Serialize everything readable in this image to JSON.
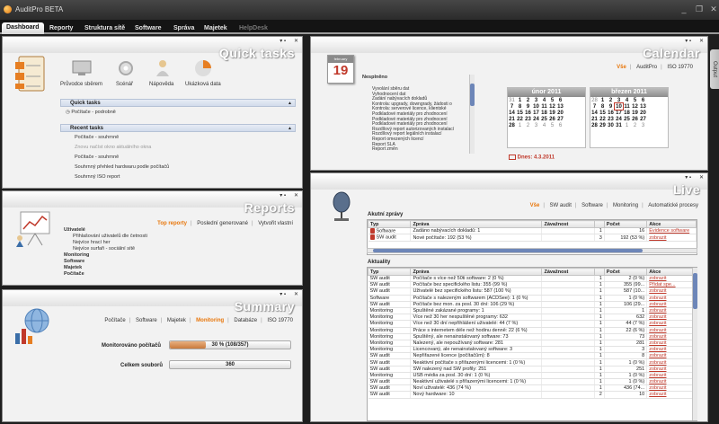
{
  "app": {
    "title": "AuditPro BETA"
  },
  "nav": {
    "tabs": [
      "Dashboard",
      "Reporty",
      "Struktura sítě",
      "Software",
      "Správa",
      "Majetek",
      "HelpDesk"
    ]
  },
  "side_tab": "Output",
  "quick_tasks": {
    "title": "Quick tasks",
    "icons": [
      "Průvodce sběrem",
      "Scénář",
      "Nápověda",
      "Ukázková data"
    ],
    "quick_header": "Quick tasks",
    "quick_items": [
      "Počítače - podrobně"
    ],
    "recent_header": "Recent tasks",
    "recent_items": [
      "Počítače - souhrnně",
      "Znovu načíst okno aktuálního okna",
      "Počítače - souhrnně",
      "Souhrnný přehled hardwaru podle počítačů",
      "Souhrnný ISO report"
    ]
  },
  "calendar": {
    "title": "Calendar",
    "tabs": [
      "Vše",
      "AuditPro",
      "ISO 19770"
    ],
    "icon_month": "february",
    "icon_day": "19",
    "list_header": "Nesplněno",
    "list": [
      "Vyvolání sběru dat",
      "Vyhodnocení dat",
      "Zadání nabývacích dokladů",
      "Kontrola: upgrady, downgrady, žádosti o",
      "Kontrola: serverové licence, klientské",
      "Podkladové materiály pro zhodnocení",
      "Podkladové materiály pro zhodnocení",
      "Podkladové materiály pro zhodnocení",
      "Rozdílový report autorizovaných instalací",
      "Rozdílový report legálních instalací",
      "Report omezených licencí",
      "Report SLA",
      "Report změn"
    ],
    "month1": {
      "name": "únor 2011",
      "rows": [
        [
          "31",
          "1",
          "2",
          "3",
          "4",
          "5",
          "6"
        ],
        [
          "7",
          "8",
          "9",
          "10",
          "11",
          "12",
          "13"
        ],
        [
          "14",
          "15",
          "16",
          "17",
          "18",
          "19",
          "20"
        ],
        [
          "21",
          "22",
          "23",
          "24",
          "25",
          "26",
          "27"
        ],
        [
          "28",
          "1",
          "2",
          "3",
          "4",
          "5",
          "6"
        ]
      ]
    },
    "month2": {
      "name": "březen 2011",
      "rows": [
        [
          "28",
          "1",
          "2",
          "3",
          "4",
          "5",
          "6"
        ],
        [
          "7",
          "8",
          "9",
          "10",
          "11",
          "12",
          "13"
        ],
        [
          "14",
          "15",
          "16",
          "17",
          "18",
          "19",
          "20"
        ],
        [
          "21",
          "22",
          "23",
          "24",
          "25",
          "26",
          "27"
        ],
        [
          "28",
          "29",
          "30",
          "31",
          "1",
          "2",
          "3"
        ]
      ]
    },
    "today": "Dnes: 4.3.2011"
  },
  "reports": {
    "title": "Reports",
    "tabs": [
      "Top reporty",
      "Poslední generované",
      "Vytvořit vlastní"
    ],
    "items": [
      "Uživatelé",
      "Přihlašování uživatelů dle četnosti",
      "Nejvíce hrací her",
      "Nejvíce surfaři - sociální sítě",
      "Monitoring",
      "Software",
      "Majetek",
      "Počítače"
    ]
  },
  "summary": {
    "title": "Summary",
    "tabs": [
      "Počítače",
      "Software",
      "Majetek",
      "Monitoring",
      "Databáze",
      "ISO 19770"
    ],
    "bars": [
      {
        "label": "Monitorováno počítačů",
        "text": "30 % (108/357)",
        "fraction": 0.3
      },
      {
        "label": "Celkem souborů",
        "text": "360",
        "fraction": 0
      }
    ]
  },
  "live": {
    "title": "Live",
    "tabs": [
      "Vše",
      "SW audit",
      "Software",
      "Monitoring",
      "Automatické procesy"
    ],
    "acute": {
      "title": "Akutní zprávy",
      "headers": [
        "Typ",
        "Zpráva",
        "Závažnost",
        "",
        "Počet",
        "Akce"
      ],
      "rows": [
        [
          "Software",
          "Zadáno nabývacích dokladů: 1",
          "",
          "1",
          "16",
          "Evidence software"
        ],
        [
          "SW audit",
          "Nové počítače: 192 (53 %)",
          "",
          "3",
          "192 (53 %)",
          "zobrazit"
        ]
      ]
    },
    "news": {
      "title": "Aktuality",
      "headers": [
        "Typ",
        "Zpráva",
        "Závažnost",
        "",
        "Počet",
        "Akce"
      ],
      "rows": [
        [
          "SW audit",
          "Počítače s více než 50ti software: 2 (0 %)",
          "",
          "1",
          "2 (0 %)",
          "zobrazit"
        ],
        [
          "SW audit",
          "Počítače bez specifického listu: 355 (99 %)",
          "",
          "1",
          "355 (99...",
          "Přidat spe..."
        ],
        [
          "SW audit",
          "Uživatelé bez specifického listu: 587 (100 %)",
          "",
          "1",
          "587 (10...",
          "zobrazit"
        ],
        [
          "Software",
          "Počítače s nalezeným softwarem (ACDSee): 1 (0 %)",
          "",
          "1",
          "1 (0 %)",
          "zobrazit"
        ],
        [
          "SW audit",
          "Počítače bez mon. za posl. 30 dní: 106 (29 %)",
          "",
          "1",
          "106 (29...",
          "zobrazit"
        ],
        [
          "Monitoring",
          "Spuštěné zakázané programy: 1",
          "",
          "1",
          "1",
          "zobrazit"
        ],
        [
          "Monitoring",
          "Více než 30 her nespuštěné programy: 632",
          "",
          "1",
          "632",
          "zobrazit"
        ],
        [
          "Monitoring",
          "Více než 30 dní nepřihlášení uživatelé: 44 (7 %)",
          "",
          "1",
          "44 (7 %)",
          "zobrazit"
        ],
        [
          "Monitoring",
          "Práce s internetem déle než hodinu denně: 22 (6 %)",
          "",
          "1",
          "22 (6 %)",
          "zobrazit"
        ],
        [
          "Monitoring",
          "Spuštěný, ale nenainstalovaný software: 73",
          "",
          "1",
          "73",
          "zobrazit"
        ],
        [
          "Monitoring",
          "Nalezený, ale nepoužívaný software: 281",
          "",
          "1",
          "281",
          "zobrazit"
        ],
        [
          "Monitoring",
          "Licencovaný, ale nenainstalovaný software: 3",
          "",
          "1",
          "3",
          "zobrazit"
        ],
        [
          "SW audit",
          "Nepřiřazené licence (počítačům): 8",
          "",
          "1",
          "8",
          "zobrazit"
        ],
        [
          "SW audit",
          "Neaktivní počítače s přiřazenými licencemi: 1 (0 %)",
          "",
          "1",
          "1 (0 %)",
          "zobrazit"
        ],
        [
          "SW audit",
          "SW nalezený nad SW profily: 251",
          "",
          "1",
          "251",
          "zobrazit"
        ],
        [
          "Monitoring",
          "USB média za posl. 30 dní: 1 (0 %)",
          "",
          "1",
          "1 (0 %)",
          "zobrazit"
        ],
        [
          "SW audit",
          "Neaktivní uživatelé s přiřazenými licencemi: 1 (0 %)",
          "",
          "1",
          "1 (0 %)",
          "zobrazit"
        ],
        [
          "SW audit",
          "Noví uživatelé: 436 (74 %)",
          "",
          "1",
          "436 (74...",
          "zobrazit"
        ],
        [
          "SW audit",
          "Nový hardware: 10",
          "",
          "2",
          "10",
          "zobrazit"
        ]
      ]
    }
  },
  "colors": {
    "accent": "#e8760a",
    "link": "#c0392b",
    "bg": "#1e1e1e"
  }
}
